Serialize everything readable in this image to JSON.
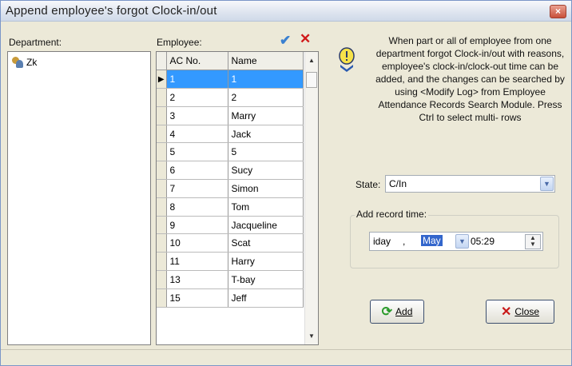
{
  "window": {
    "title": "Append employee's forgot Clock-in/out",
    "close_glyph": "×"
  },
  "department": {
    "label": "Department:",
    "items": [
      {
        "label": "Zk",
        "icon": "group-icon"
      }
    ]
  },
  "employee": {
    "label": "Employee:",
    "confirm_glyph": "✔",
    "cancel_glyph": "✕",
    "columns": {
      "ac_no": "AC No.",
      "name": "Name"
    },
    "rows": [
      {
        "ac": "1",
        "name": "1",
        "selected": true
      },
      {
        "ac": "2",
        "name": "2"
      },
      {
        "ac": "3",
        "name": "Marry"
      },
      {
        "ac": "4",
        "name": "Jack"
      },
      {
        "ac": "5",
        "name": "5"
      },
      {
        "ac": "6",
        "name": "Sucy"
      },
      {
        "ac": "7",
        "name": "Simon"
      },
      {
        "ac": "8",
        "name": "Tom"
      },
      {
        "ac": "9",
        "name": "Jacqueline"
      },
      {
        "ac": "10",
        "name": "Scat"
      },
      {
        "ac": "11",
        "name": "Harry"
      },
      {
        "ac": "13",
        "name": "T-bay"
      },
      {
        "ac": "15",
        "name": "Jeff"
      }
    ]
  },
  "info_text": "When part or all of employee from one department forgot Clock-in/out with reasons, employee's clock-in/clock-out time can be added, and the changes can be searched by using <Modify Log> from Employee Attendance Records Search Module. Press Ctrl to select multi- rows",
  "state": {
    "label": "State:",
    "value": "C/In"
  },
  "record_time": {
    "group_label": "Add record time:",
    "day": "iday",
    "comma": ",",
    "month": "May",
    "time": "05:29"
  },
  "buttons": {
    "add": "Add",
    "close": "Close"
  },
  "colors": {
    "selection": "#3399ff",
    "accent": "#3366cc",
    "window_bg": "#ece9d8"
  }
}
